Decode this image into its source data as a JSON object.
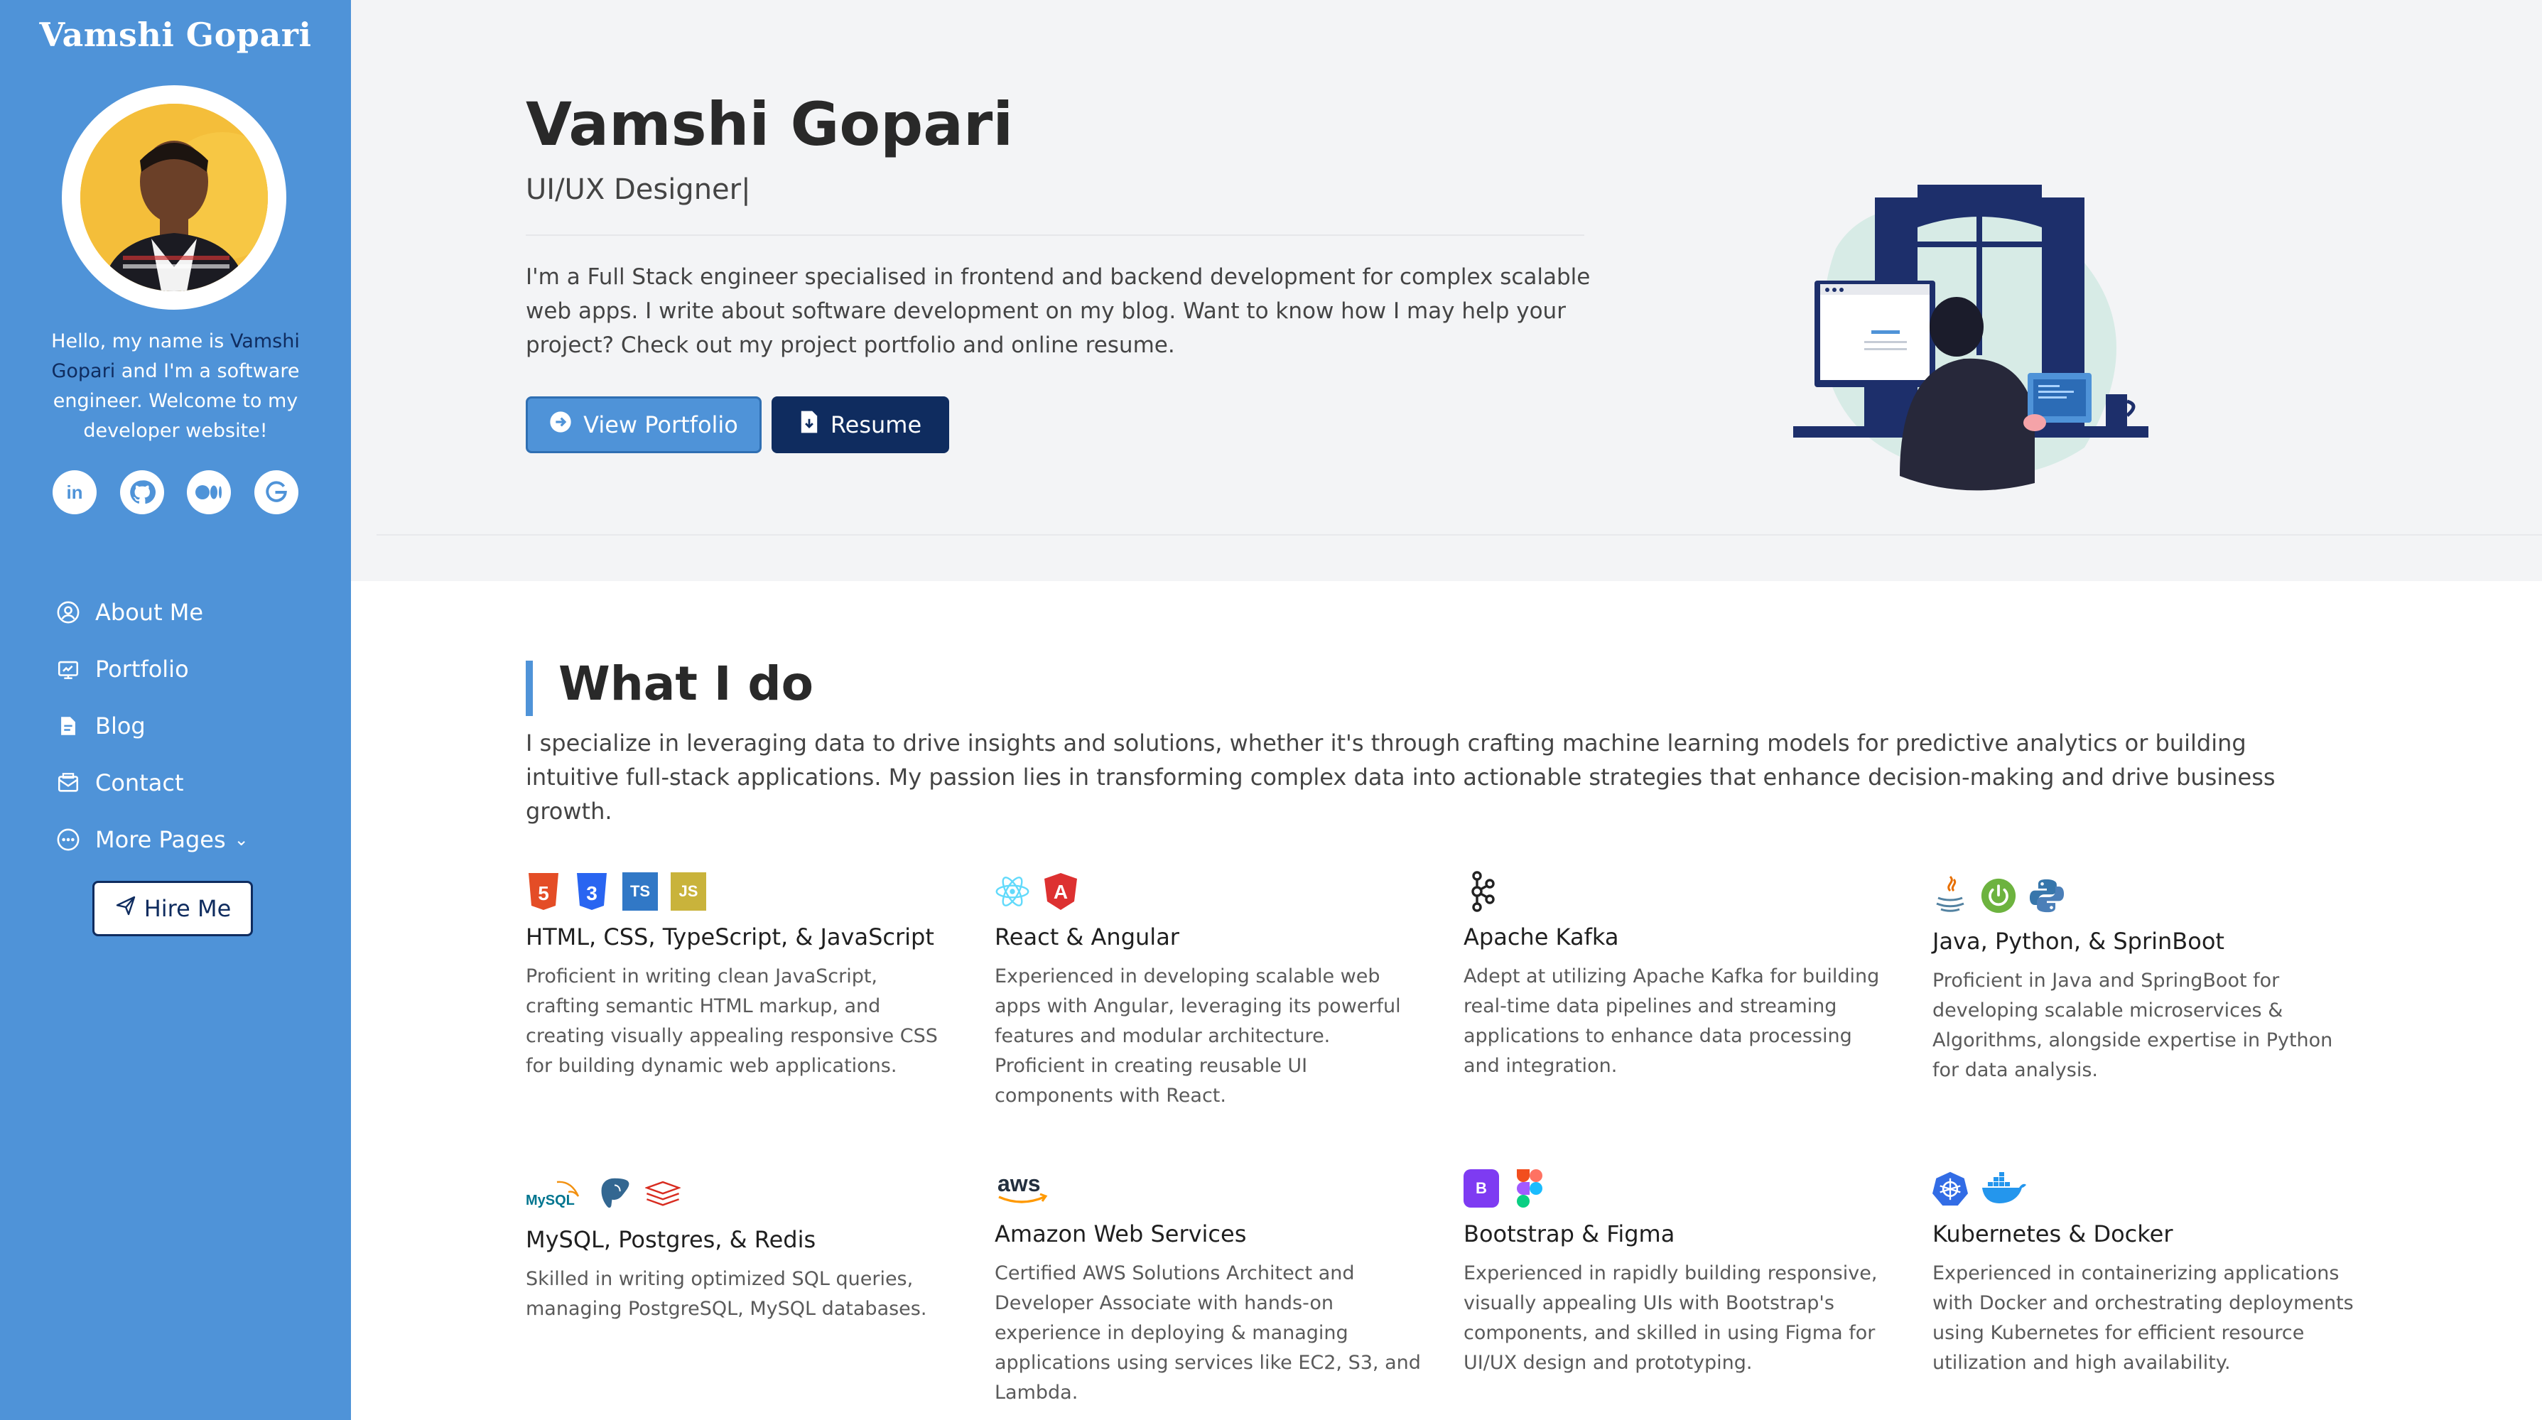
{
  "sidebar": {
    "brand": "Vamshi Gopari",
    "bio_prefix": "Hello, my name is ",
    "bio_name": "Vamshi Gopari",
    "bio_suffix": " and I'm a software engineer. Welcome to my developer website!",
    "socials": [
      "linkedin-icon",
      "github-icon",
      "medium-icon",
      "other-icon"
    ],
    "nav": [
      {
        "label": "About Me",
        "icon": "user-circle-icon"
      },
      {
        "label": "Portfolio",
        "icon": "portfolio-icon"
      },
      {
        "label": "Blog",
        "icon": "blog-icon"
      },
      {
        "label": "Contact",
        "icon": "contact-icon"
      },
      {
        "label": "More Pages",
        "icon": "more-icon"
      }
    ],
    "hire_label": "Hire Me"
  },
  "hero": {
    "name": "Vamshi Gopari",
    "role": "UI/UX Designer|",
    "intro": "I'm a Full Stack engineer specialised in frontend and backend development for complex scalable web apps. I write about software development on my blog. Want to know how I may help your project? Check out my project portfolio and online resume.",
    "portfolio_label": "View Portfolio",
    "resume_label": "Resume"
  },
  "what_i_do": {
    "title": "What I do",
    "description": "I specialize in leveraging data to drive insights and solutions, whether it's through crafting machine learning models for predictive analytics or building intuitive full-stack applications. My passion lies in transforming complex data into actionable strategies that enhance decision-making and drive business growth.",
    "cards": [
      {
        "title": "HTML, CSS, TypeScript, & JavaScript",
        "desc": "Proficient in writing clean JavaScript, crafting semantic HTML markup, and creating visually appealing responsive CSS for building dynamic web applications."
      },
      {
        "title": "React & Angular",
        "desc": "Experienced in developing scalable web apps with Angular, leveraging its powerful features and modular architecture. Proficient in creating reusable UI components with React."
      },
      {
        "title": "Apache Kafka",
        "desc": "Adept at utilizing Apache Kafka for building real-time data pipelines and streaming applications to enhance data processing and integration."
      },
      {
        "title": "Java, Python, & SprinBoot",
        "desc": "Proficient in Java and SpringBoot for developing scalable microservices & Algorithms, alongside expertise in Python for data analysis."
      },
      {
        "title": "MySQL, Postgres, & Redis",
        "desc": "Skilled in writing optimized SQL queries, managing PostgreSQL, MySQL databases."
      },
      {
        "title": "Amazon Web Services",
        "desc": "Certified AWS Solutions Architect and Developer Associate with hands-on experience in deploying & managing applications using services like EC2, S3, and Lambda."
      },
      {
        "title": "Bootstrap & Figma",
        "desc": "Experienced in rapidly building responsive, visually appealing UIs with Bootstrap's components, and skilled in using Figma for UI/UX design and prototyping."
      },
      {
        "title": "Kubernetes & Docker",
        "desc": "Experienced in containerizing applications with Docker and orchestrating deployments using Kubernetes for efficient resource utilization and high availability."
      }
    ],
    "icon_labels": {
      "ts": "TS",
      "js": "JS",
      "html5": "5",
      "css3": "3",
      "angular": "A",
      "bootstrap": "B",
      "mysql": "MySQL",
      "aws": "aws"
    }
  },
  "colors": {
    "sidebar": "#4f93d8",
    "primary_dark": "#0f2c5f",
    "hero_bg": "#f3f4f6"
  }
}
